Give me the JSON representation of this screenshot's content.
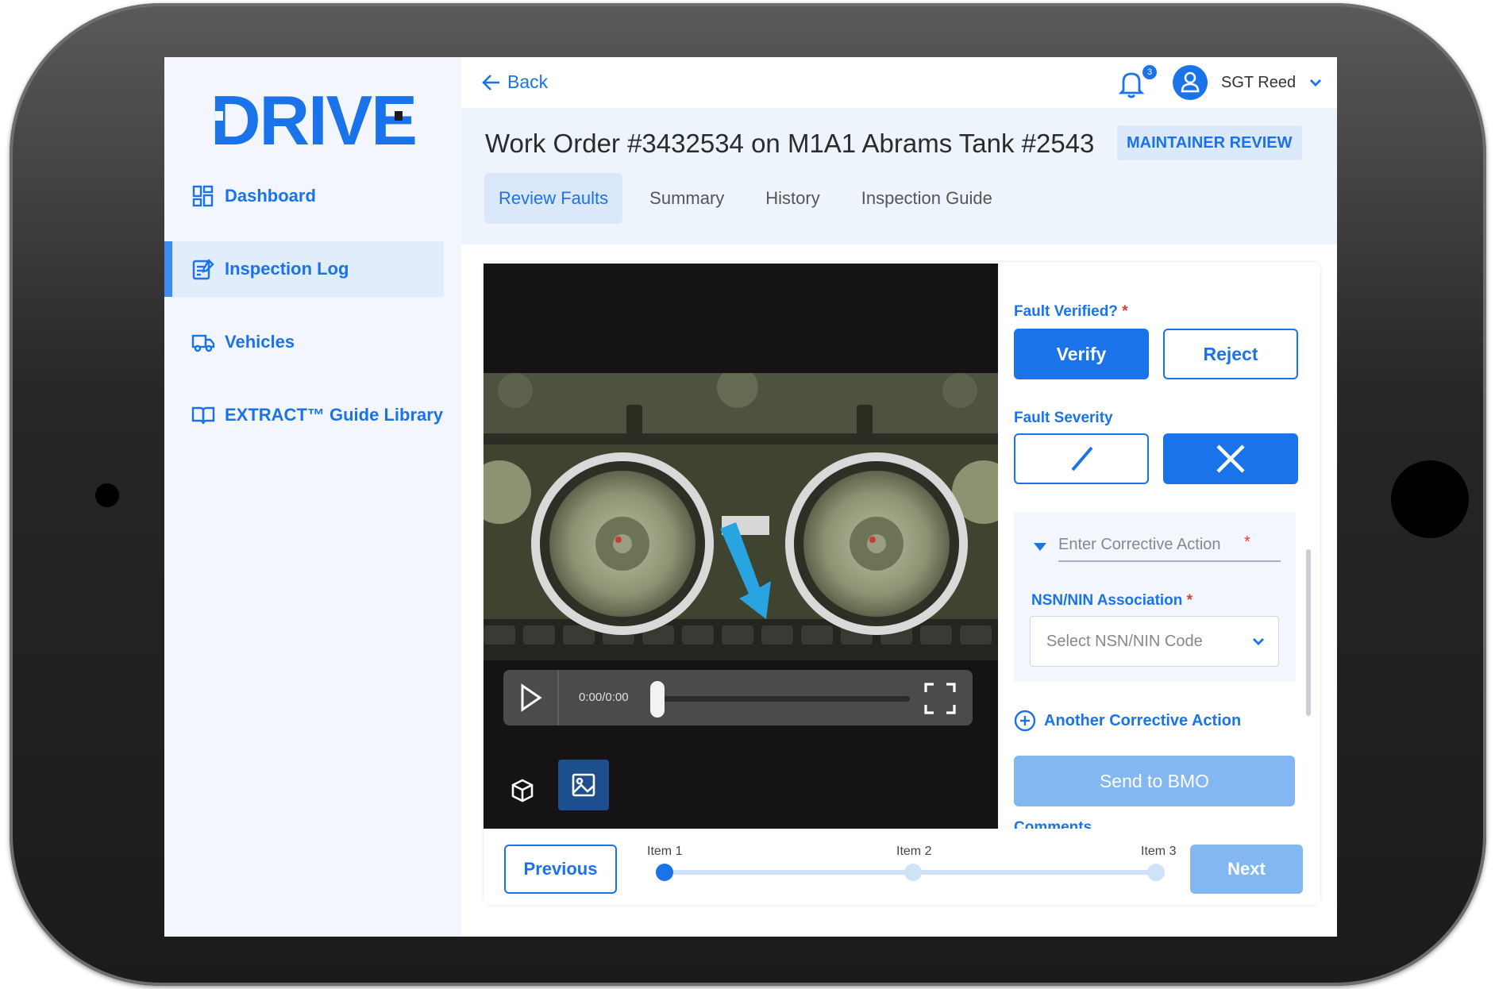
{
  "brand": {
    "logo_text": "DRIVE",
    "color": "#1a73e8"
  },
  "sidebar": {
    "items": [
      {
        "label": "Dashboard",
        "icon": "dashboard-icon",
        "active": false
      },
      {
        "label": "Inspection Log",
        "icon": "clipboard-edit-icon",
        "active": true
      },
      {
        "label": "Vehicles",
        "icon": "truck-icon",
        "active": false
      },
      {
        "label": "EXTRACT™ Guide Library",
        "icon": "book-icon",
        "active": false
      }
    ]
  },
  "header": {
    "back_label": "Back",
    "notification_count": "3",
    "user_name": "SGT Reed"
  },
  "page": {
    "title": "Work Order #3432534 on M1A1 Abrams Tank #2543",
    "status_badge": "MAINTAINER REVIEW"
  },
  "tabs": [
    {
      "label": "Review Faults",
      "active": true
    },
    {
      "label": "Summary",
      "active": false
    },
    {
      "label": "History",
      "active": false
    },
    {
      "label": "Inspection Guide",
      "active": false
    }
  ],
  "media": {
    "time_display": "0:00/0:00",
    "progress": 0,
    "view_modes": [
      "3d-cube-icon",
      "image-icon"
    ],
    "active_view": "image-icon"
  },
  "form": {
    "fault_verified_label": "Fault Verified?",
    "verify_label": "Verify",
    "reject_label": "Reject",
    "fault_severity_label": "Fault Severity",
    "severity_options": [
      "slash-icon",
      "close-icon"
    ],
    "selected_severity": "close-icon",
    "corrective_action_placeholder": "Enter Corrective Action",
    "nsn_label": "NSN/NIN Association",
    "nsn_placeholder": "Select NSN/NIN Code",
    "add_action_label": "Another Corrective Action",
    "send_label": "Send to BMO",
    "comments_label": "Comments"
  },
  "footer": {
    "previous_label": "Previous",
    "next_label": "Next",
    "steps": [
      "Item 1",
      "Item 2",
      "Item 3"
    ],
    "current_step": 0
  },
  "colors": {
    "accent": "#1a73e8",
    "accent_light": "#83b7f2",
    "required": "#e53935"
  }
}
